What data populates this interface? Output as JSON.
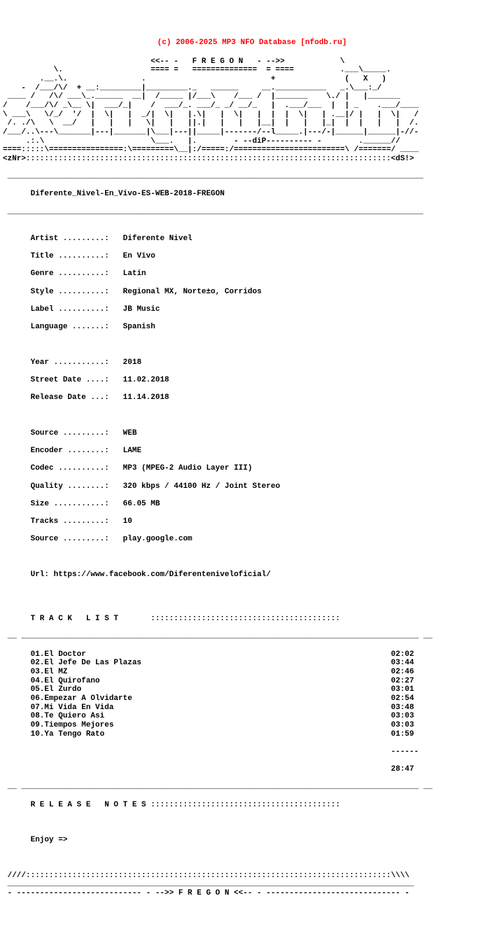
{
  "header": "(c) 2006-2025 MP3 NFO Database [nfodb.ru]",
  "ascii_top": "                                <<-- -   F R E G O N   - -->>            \\\n           \\.                   ==== =   ==============  = ====          .___\\_____.\n        .__.\\.                .                           +               (   X   )\n    -  /___/\\/  + __:_________|_________._   ______     __.___________   _.\\___:_/\n ____ /   /\\/ ___\\_.______  __|  /_____ |/___\\    /___ /  |_______    \\./ |   |_______\n/    /___/\\/ _\\__ \\|  ___/_|    /  ___/_. ___/_ _/ __/_   |  .___/___  |  | _    .___/____\n\\ ___\\   \\/_/  '/  |  \\|   |  _/|  \\|   |.\\|   |  \\|   |  |  |  \\|   | .__|/ |   |  \\|   /\n /. ./\\   \\  __/   |   |   |   \\|   |   ||.|   |   |   |__|  |   |   |_|  |  |   |   |  /.\n/___/..\\---\\_______|---|_______|\\___|---||_____|-------/--l_____.|---/-|______|______|-//-\n     .:.\\                       \\___.   |.        - --diP---------- -        .______//\n====:::::\\================:\\=========\\__|:/=====:/========================\\ /=======/ ____\n<zNr>:::::::::::::::::::::::::::::::::::::::::::::::::::::::::::::::::::::::::::::::<dS!>",
  "release_name": "Diferente_Nivel-En_Vivo-ES-WEB-2018-FREGON",
  "info": {
    "artist_label": "Artist .........:",
    "artist": "Diferente Nivel",
    "title_label": "Title ..........:",
    "title": "En Vivo",
    "genre_label": "Genre ..........:",
    "genre": "Latin",
    "style_label": "Style ..........:",
    "style": "Regional MX, Norte±o, Corridos",
    "label_label": "Label ..........:",
    "label": "JB Music",
    "language_label": "Language .......:",
    "language": "Spanish",
    "year_label": "Year ...........:",
    "year": "2018",
    "street_label": "Street Date ....:",
    "street": "11.02.2018",
    "release_label": "Release Date ...:",
    "release": "11.14.2018",
    "source_label": "Source .........:",
    "source": "WEB",
    "encoder_label": "Encoder ........:",
    "encoder": "LAME",
    "codec_label": "Codec ..........:",
    "codec": "MP3 (MPEG-2 Audio Layer III)",
    "quality_label": "Quality ........:",
    "quality": "320 kbps / 44100 Hz / Joint Stereo",
    "size_label": "Size ...........:",
    "size": "66.05 MB",
    "tracks_label": "Tracks .........:",
    "tracks": "10",
    "source2_label": "Source .........:",
    "source2": "play.google.com",
    "url_label": "Url:",
    "url": "https://www.facebook.com/Diferenteniveloficial/"
  },
  "tracklist_header": "T R A C K   L I S T       :::::::::::::::::::::::::::::::::::::::::",
  "tracks_list": [
    {
      "n": "01",
      "name": "El Doctor",
      "time": "02:02"
    },
    {
      "n": "02",
      "name": "El Jefe De Las Plazas",
      "time": "03:44"
    },
    {
      "n": "03",
      "name": "El MZ",
      "time": "02:46"
    },
    {
      "n": "04",
      "name": "El Quirofano",
      "time": "02:27"
    },
    {
      "n": "05",
      "name": "El Zurdo",
      "time": "03:01"
    },
    {
      "n": "06",
      "name": "Empezar A Olvidarte",
      "time": "02:54"
    },
    {
      "n": "07",
      "name": "Mi Vida En Vida",
      "time": "03:48"
    },
    {
      "n": "08",
      "name": "Te Quiero Asi",
      "time": "03:03"
    },
    {
      "n": "09",
      "name": "Tiempos Mejores",
      "time": "03:03"
    },
    {
      "n": "10",
      "name": "Ya Tengo Rato",
      "time": "01:59"
    }
  ],
  "total_time": "28:47",
  "notes_header": "R E L E A S E   N O T E S :::::::::::::::::::::::::::::::::::::::::",
  "notes_text": "Enjoy =>",
  "footer": " ////:::::::::::::::::::::::::::::::::::::::::::::::::::::::::::::::::::::::::::::::\\\\\\\\\n ________________________________________________________________________________________\n - --------------------------- - -->> F R E G O N <<-- - ----------------------------- -"
}
